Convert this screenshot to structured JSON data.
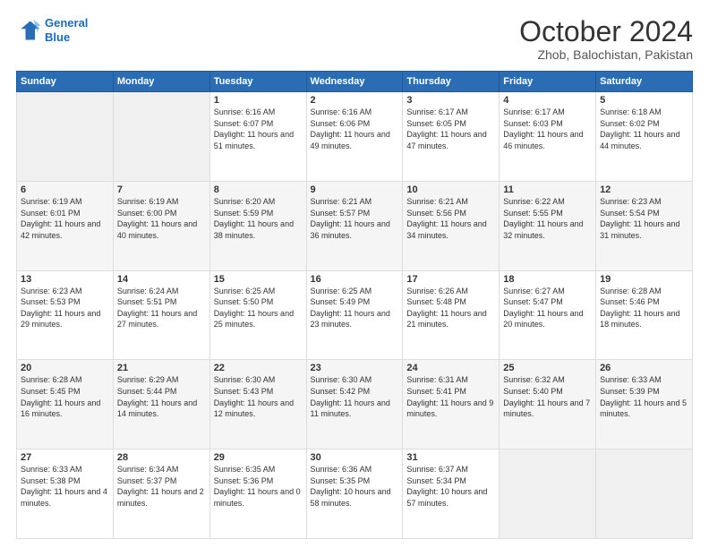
{
  "header": {
    "logo_line1": "General",
    "logo_line2": "Blue",
    "month": "October 2024",
    "location": "Zhob, Balochistan, Pakistan"
  },
  "days_of_week": [
    "Sunday",
    "Monday",
    "Tuesday",
    "Wednesday",
    "Thursday",
    "Friday",
    "Saturday"
  ],
  "weeks": [
    [
      {
        "day": "",
        "info": ""
      },
      {
        "day": "",
        "info": ""
      },
      {
        "day": "1",
        "info": "Sunrise: 6:16 AM\nSunset: 6:07 PM\nDaylight: 11 hours and 51 minutes."
      },
      {
        "day": "2",
        "info": "Sunrise: 6:16 AM\nSunset: 6:06 PM\nDaylight: 11 hours and 49 minutes."
      },
      {
        "day": "3",
        "info": "Sunrise: 6:17 AM\nSunset: 6:05 PM\nDaylight: 11 hours and 47 minutes."
      },
      {
        "day": "4",
        "info": "Sunrise: 6:17 AM\nSunset: 6:03 PM\nDaylight: 11 hours and 46 minutes."
      },
      {
        "day": "5",
        "info": "Sunrise: 6:18 AM\nSunset: 6:02 PM\nDaylight: 11 hours and 44 minutes."
      }
    ],
    [
      {
        "day": "6",
        "info": "Sunrise: 6:19 AM\nSunset: 6:01 PM\nDaylight: 11 hours and 42 minutes."
      },
      {
        "day": "7",
        "info": "Sunrise: 6:19 AM\nSunset: 6:00 PM\nDaylight: 11 hours and 40 minutes."
      },
      {
        "day": "8",
        "info": "Sunrise: 6:20 AM\nSunset: 5:59 PM\nDaylight: 11 hours and 38 minutes."
      },
      {
        "day": "9",
        "info": "Sunrise: 6:21 AM\nSunset: 5:57 PM\nDaylight: 11 hours and 36 minutes."
      },
      {
        "day": "10",
        "info": "Sunrise: 6:21 AM\nSunset: 5:56 PM\nDaylight: 11 hours and 34 minutes."
      },
      {
        "day": "11",
        "info": "Sunrise: 6:22 AM\nSunset: 5:55 PM\nDaylight: 11 hours and 32 minutes."
      },
      {
        "day": "12",
        "info": "Sunrise: 6:23 AM\nSunset: 5:54 PM\nDaylight: 11 hours and 31 minutes."
      }
    ],
    [
      {
        "day": "13",
        "info": "Sunrise: 6:23 AM\nSunset: 5:53 PM\nDaylight: 11 hours and 29 minutes."
      },
      {
        "day": "14",
        "info": "Sunrise: 6:24 AM\nSunset: 5:51 PM\nDaylight: 11 hours and 27 minutes."
      },
      {
        "day": "15",
        "info": "Sunrise: 6:25 AM\nSunset: 5:50 PM\nDaylight: 11 hours and 25 minutes."
      },
      {
        "day": "16",
        "info": "Sunrise: 6:25 AM\nSunset: 5:49 PM\nDaylight: 11 hours and 23 minutes."
      },
      {
        "day": "17",
        "info": "Sunrise: 6:26 AM\nSunset: 5:48 PM\nDaylight: 11 hours and 21 minutes."
      },
      {
        "day": "18",
        "info": "Sunrise: 6:27 AM\nSunset: 5:47 PM\nDaylight: 11 hours and 20 minutes."
      },
      {
        "day": "19",
        "info": "Sunrise: 6:28 AM\nSunset: 5:46 PM\nDaylight: 11 hours and 18 minutes."
      }
    ],
    [
      {
        "day": "20",
        "info": "Sunrise: 6:28 AM\nSunset: 5:45 PM\nDaylight: 11 hours and 16 minutes."
      },
      {
        "day": "21",
        "info": "Sunrise: 6:29 AM\nSunset: 5:44 PM\nDaylight: 11 hours and 14 minutes."
      },
      {
        "day": "22",
        "info": "Sunrise: 6:30 AM\nSunset: 5:43 PM\nDaylight: 11 hours and 12 minutes."
      },
      {
        "day": "23",
        "info": "Sunrise: 6:30 AM\nSunset: 5:42 PM\nDaylight: 11 hours and 11 minutes."
      },
      {
        "day": "24",
        "info": "Sunrise: 6:31 AM\nSunset: 5:41 PM\nDaylight: 11 hours and 9 minutes."
      },
      {
        "day": "25",
        "info": "Sunrise: 6:32 AM\nSunset: 5:40 PM\nDaylight: 11 hours and 7 minutes."
      },
      {
        "day": "26",
        "info": "Sunrise: 6:33 AM\nSunset: 5:39 PM\nDaylight: 11 hours and 5 minutes."
      }
    ],
    [
      {
        "day": "27",
        "info": "Sunrise: 6:33 AM\nSunset: 5:38 PM\nDaylight: 11 hours and 4 minutes."
      },
      {
        "day": "28",
        "info": "Sunrise: 6:34 AM\nSunset: 5:37 PM\nDaylight: 11 hours and 2 minutes."
      },
      {
        "day": "29",
        "info": "Sunrise: 6:35 AM\nSunset: 5:36 PM\nDaylight: 11 hours and 0 minutes."
      },
      {
        "day": "30",
        "info": "Sunrise: 6:36 AM\nSunset: 5:35 PM\nDaylight: 10 hours and 58 minutes."
      },
      {
        "day": "31",
        "info": "Sunrise: 6:37 AM\nSunset: 5:34 PM\nDaylight: 10 hours and 57 minutes."
      },
      {
        "day": "",
        "info": ""
      },
      {
        "day": "",
        "info": ""
      }
    ]
  ]
}
